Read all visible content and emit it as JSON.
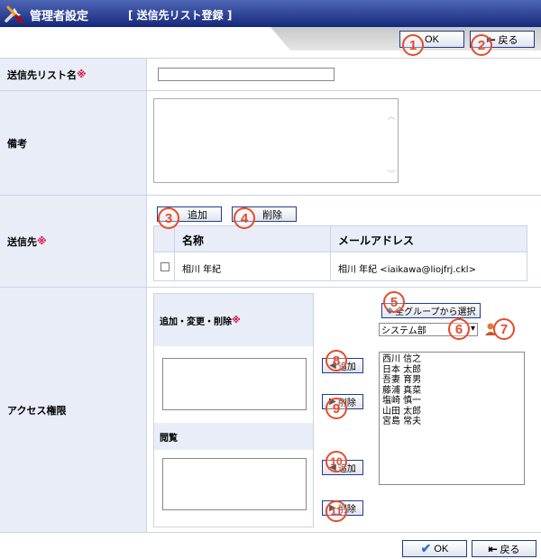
{
  "header": {
    "title": "管理者設定",
    "subtitle": "[ 送信先リスト登録 ]"
  },
  "toolbar": {
    "ok_label": "OK",
    "back_label": "戻る"
  },
  "form": {
    "list_name_label": "送信先リスト名",
    "required_mark": "※",
    "list_name_value": "",
    "remarks_label": "備考",
    "remarks_value": "",
    "destinations_label": "送信先",
    "add_label": "追加",
    "delete_label": "削除",
    "table": {
      "columns": [
        "名称",
        "メールアドレス"
      ],
      "rows": [
        {
          "name": "相川 年紀",
          "email": "相川 年紀 <iaikawa@liojfrj.ckl>"
        }
      ]
    },
    "access_label": "アクセス権限",
    "edit_label": "追加・変更・削除",
    "view_label": "閲覧",
    "access_add_label": "追加",
    "access_delete_label": "削除",
    "group_select_button": "全グループから選択",
    "group_select_value": "システム部",
    "members": [
      "西川 信之",
      "日本 太郎",
      "吾妻 育男",
      "藤浦 真菜",
      "塩崎 慎一",
      "山田 太郎",
      "宮島 常夫"
    ]
  },
  "badges": [
    "1",
    "2",
    "3",
    "4",
    "5",
    "6",
    "7",
    "8",
    "9",
    "10",
    "11"
  ],
  "colors": {
    "header": "#1f3589",
    "label_bg": "#e8edf8",
    "badge": "#e84a28",
    "required": "#e0003a"
  }
}
